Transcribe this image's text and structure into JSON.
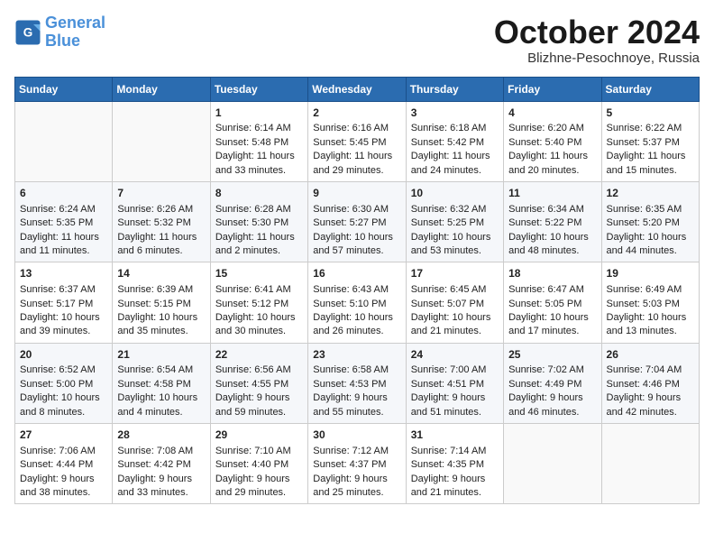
{
  "header": {
    "logo_line1": "General",
    "logo_line2": "Blue",
    "month_title": "October 2024",
    "location": "Blizhne-Pesochnoye, Russia"
  },
  "days_of_week": [
    "Sunday",
    "Monday",
    "Tuesday",
    "Wednesday",
    "Thursday",
    "Friday",
    "Saturday"
  ],
  "weeks": [
    [
      {
        "day": "",
        "sunrise": "",
        "sunset": "",
        "daylight": ""
      },
      {
        "day": "",
        "sunrise": "",
        "sunset": "",
        "daylight": ""
      },
      {
        "day": "1",
        "sunrise": "Sunrise: 6:14 AM",
        "sunset": "Sunset: 5:48 PM",
        "daylight": "Daylight: 11 hours and 33 minutes."
      },
      {
        "day": "2",
        "sunrise": "Sunrise: 6:16 AM",
        "sunset": "Sunset: 5:45 PM",
        "daylight": "Daylight: 11 hours and 29 minutes."
      },
      {
        "day": "3",
        "sunrise": "Sunrise: 6:18 AM",
        "sunset": "Sunset: 5:42 PM",
        "daylight": "Daylight: 11 hours and 24 minutes."
      },
      {
        "day": "4",
        "sunrise": "Sunrise: 6:20 AM",
        "sunset": "Sunset: 5:40 PM",
        "daylight": "Daylight: 11 hours and 20 minutes."
      },
      {
        "day": "5",
        "sunrise": "Sunrise: 6:22 AM",
        "sunset": "Sunset: 5:37 PM",
        "daylight": "Daylight: 11 hours and 15 minutes."
      }
    ],
    [
      {
        "day": "6",
        "sunrise": "Sunrise: 6:24 AM",
        "sunset": "Sunset: 5:35 PM",
        "daylight": "Daylight: 11 hours and 11 minutes."
      },
      {
        "day": "7",
        "sunrise": "Sunrise: 6:26 AM",
        "sunset": "Sunset: 5:32 PM",
        "daylight": "Daylight: 11 hours and 6 minutes."
      },
      {
        "day": "8",
        "sunrise": "Sunrise: 6:28 AM",
        "sunset": "Sunset: 5:30 PM",
        "daylight": "Daylight: 11 hours and 2 minutes."
      },
      {
        "day": "9",
        "sunrise": "Sunrise: 6:30 AM",
        "sunset": "Sunset: 5:27 PM",
        "daylight": "Daylight: 10 hours and 57 minutes."
      },
      {
        "day": "10",
        "sunrise": "Sunrise: 6:32 AM",
        "sunset": "Sunset: 5:25 PM",
        "daylight": "Daylight: 10 hours and 53 minutes."
      },
      {
        "day": "11",
        "sunrise": "Sunrise: 6:34 AM",
        "sunset": "Sunset: 5:22 PM",
        "daylight": "Daylight: 10 hours and 48 minutes."
      },
      {
        "day": "12",
        "sunrise": "Sunrise: 6:35 AM",
        "sunset": "Sunset: 5:20 PM",
        "daylight": "Daylight: 10 hours and 44 minutes."
      }
    ],
    [
      {
        "day": "13",
        "sunrise": "Sunrise: 6:37 AM",
        "sunset": "Sunset: 5:17 PM",
        "daylight": "Daylight: 10 hours and 39 minutes."
      },
      {
        "day": "14",
        "sunrise": "Sunrise: 6:39 AM",
        "sunset": "Sunset: 5:15 PM",
        "daylight": "Daylight: 10 hours and 35 minutes."
      },
      {
        "day": "15",
        "sunrise": "Sunrise: 6:41 AM",
        "sunset": "Sunset: 5:12 PM",
        "daylight": "Daylight: 10 hours and 30 minutes."
      },
      {
        "day": "16",
        "sunrise": "Sunrise: 6:43 AM",
        "sunset": "Sunset: 5:10 PM",
        "daylight": "Daylight: 10 hours and 26 minutes."
      },
      {
        "day": "17",
        "sunrise": "Sunrise: 6:45 AM",
        "sunset": "Sunset: 5:07 PM",
        "daylight": "Daylight: 10 hours and 21 minutes."
      },
      {
        "day": "18",
        "sunrise": "Sunrise: 6:47 AM",
        "sunset": "Sunset: 5:05 PM",
        "daylight": "Daylight: 10 hours and 17 minutes."
      },
      {
        "day": "19",
        "sunrise": "Sunrise: 6:49 AM",
        "sunset": "Sunset: 5:03 PM",
        "daylight": "Daylight: 10 hours and 13 minutes."
      }
    ],
    [
      {
        "day": "20",
        "sunrise": "Sunrise: 6:52 AM",
        "sunset": "Sunset: 5:00 PM",
        "daylight": "Daylight: 10 hours and 8 minutes."
      },
      {
        "day": "21",
        "sunrise": "Sunrise: 6:54 AM",
        "sunset": "Sunset: 4:58 PM",
        "daylight": "Daylight: 10 hours and 4 minutes."
      },
      {
        "day": "22",
        "sunrise": "Sunrise: 6:56 AM",
        "sunset": "Sunset: 4:55 PM",
        "daylight": "Daylight: 9 hours and 59 minutes."
      },
      {
        "day": "23",
        "sunrise": "Sunrise: 6:58 AM",
        "sunset": "Sunset: 4:53 PM",
        "daylight": "Daylight: 9 hours and 55 minutes."
      },
      {
        "day": "24",
        "sunrise": "Sunrise: 7:00 AM",
        "sunset": "Sunset: 4:51 PM",
        "daylight": "Daylight: 9 hours and 51 minutes."
      },
      {
        "day": "25",
        "sunrise": "Sunrise: 7:02 AM",
        "sunset": "Sunset: 4:49 PM",
        "daylight": "Daylight: 9 hours and 46 minutes."
      },
      {
        "day": "26",
        "sunrise": "Sunrise: 7:04 AM",
        "sunset": "Sunset: 4:46 PM",
        "daylight": "Daylight: 9 hours and 42 minutes."
      }
    ],
    [
      {
        "day": "27",
        "sunrise": "Sunrise: 7:06 AM",
        "sunset": "Sunset: 4:44 PM",
        "daylight": "Daylight: 9 hours and 38 minutes."
      },
      {
        "day": "28",
        "sunrise": "Sunrise: 7:08 AM",
        "sunset": "Sunset: 4:42 PM",
        "daylight": "Daylight: 9 hours and 33 minutes."
      },
      {
        "day": "29",
        "sunrise": "Sunrise: 7:10 AM",
        "sunset": "Sunset: 4:40 PM",
        "daylight": "Daylight: 9 hours and 29 minutes."
      },
      {
        "day": "30",
        "sunrise": "Sunrise: 7:12 AM",
        "sunset": "Sunset: 4:37 PM",
        "daylight": "Daylight: 9 hours and 25 minutes."
      },
      {
        "day": "31",
        "sunrise": "Sunrise: 7:14 AM",
        "sunset": "Sunset: 4:35 PM",
        "daylight": "Daylight: 9 hours and 21 minutes."
      },
      {
        "day": "",
        "sunrise": "",
        "sunset": "",
        "daylight": ""
      },
      {
        "day": "",
        "sunrise": "",
        "sunset": "",
        "daylight": ""
      }
    ]
  ]
}
